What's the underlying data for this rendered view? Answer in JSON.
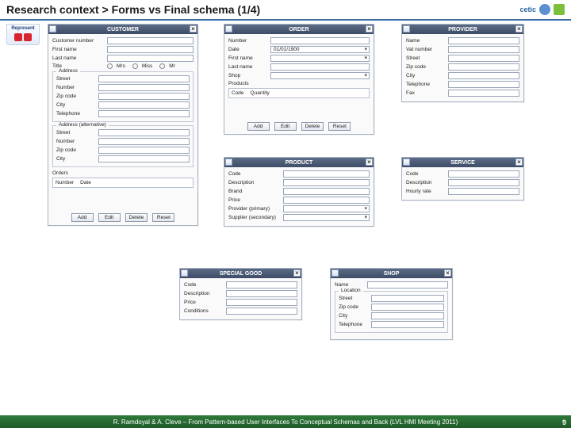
{
  "header": {
    "title": "Research context > Forms vs Final schema (1/4)",
    "logo_text": "cetic"
  },
  "ribbon": {
    "label": "Represent"
  },
  "windows": {
    "customer": {
      "title": "CUSTOMER",
      "fields": {
        "custnum": "Customer number",
        "firstname": "First name",
        "lastname": "Last name",
        "title": "Title",
        "title_opts": {
          "mrs": "Mrs",
          "miss": "Miss",
          "mr": "Mr"
        }
      },
      "address_group": "Address",
      "address_alt_group": "Address (alternative)",
      "addr": {
        "street": "Street",
        "number": "Number",
        "zip": "Zip code",
        "city": "City",
        "tel": "Telephone"
      },
      "orders_label": "Orders",
      "orders_cols": {
        "number": "Number",
        "date": "Date"
      },
      "buttons": {
        "add": "Add",
        "edit": "Edit",
        "delete": "Delete",
        "reset": "Reset"
      }
    },
    "order": {
      "title": "ORDER",
      "fields": {
        "number": "Number",
        "date": "Date",
        "date_val": "01/01/1900",
        "firstname": "First name",
        "lastname": "Last name",
        "shop": "Shop"
      },
      "products_label": "Products",
      "prod_cols": {
        "code": "Code",
        "qty": "Quantity"
      },
      "buttons": {
        "add": "Add",
        "edit": "Edit",
        "delete": "Delete",
        "reset": "Reset"
      }
    },
    "provider": {
      "title": "PROVIDER",
      "fields": {
        "name": "Name",
        "vat": "Vat number",
        "street": "Street",
        "zip": "Zip code",
        "city": "City",
        "tel": "Telephone",
        "fax": "Fax"
      }
    },
    "product": {
      "title": "PRODUCT",
      "fields": {
        "code": "Code",
        "desc": "Description",
        "brand": "Brand",
        "price": "Price",
        "prov1": "Provider (primary)",
        "prov2": "Supplier (secondary)"
      }
    },
    "service": {
      "title": "SERVICE",
      "fields": {
        "code": "Code",
        "desc": "Description",
        "rate": "Hourly rate"
      }
    },
    "special": {
      "title": "SPECIAL GOOD",
      "fields": {
        "code": "Code",
        "desc": "Description",
        "price": "Price",
        "cond": "Conditions"
      }
    },
    "shop": {
      "title": "SHOP",
      "fields": {
        "name": "Name"
      },
      "loc_group": "Location",
      "loc": {
        "street": "Street",
        "zip": "Zip code",
        "city": "City",
        "tel": "Telephone"
      }
    }
  },
  "footer": {
    "text": "R. Ramdoyal & A. Cleve – From Pattern-based User Interfaces To Conceptual Schemas and Back (LVL HMI Meeting 2011)",
    "slide": "9"
  }
}
